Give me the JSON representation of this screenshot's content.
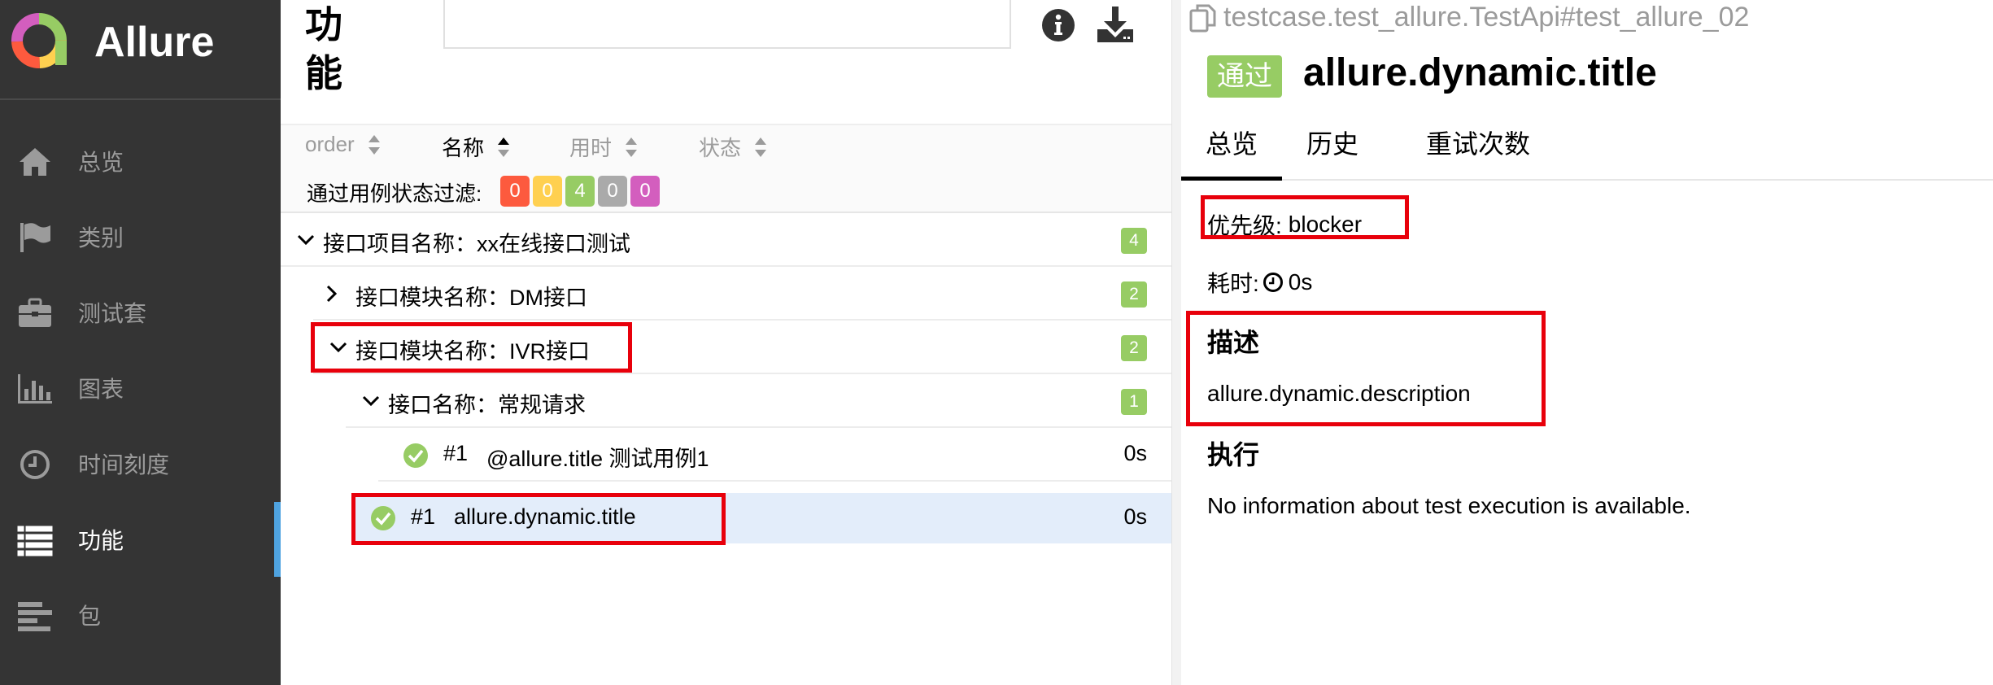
{
  "app": {
    "name": "Allure"
  },
  "sidebar": {
    "items": [
      {
        "label": "总览",
        "icon": "home-icon"
      },
      {
        "label": "类别",
        "icon": "flag-icon"
      },
      {
        "label": "测试套",
        "icon": "briefcase-icon"
      },
      {
        "label": "图表",
        "icon": "bar-chart-icon"
      },
      {
        "label": "时间刻度",
        "icon": "clock-icon"
      },
      {
        "label": "功能",
        "icon": "list-icon",
        "active": true
      },
      {
        "label": "包",
        "icon": "align-left-icon"
      }
    ]
  },
  "middle": {
    "title": "功能",
    "search": {
      "placeholder": ""
    },
    "sort": [
      {
        "label": "order",
        "active": false
      },
      {
        "label": "名称",
        "active": true
      },
      {
        "label": "用时",
        "active": false
      },
      {
        "label": "状态",
        "active": false
      }
    ],
    "filter": {
      "label": "通过用例状态过滤:",
      "chips": [
        {
          "value": "0",
          "color": "#fd5a3e",
          "status": "failed"
        },
        {
          "value": "0",
          "color": "#ffd050",
          "status": "broken"
        },
        {
          "value": "4",
          "color": "#97cc64",
          "status": "passed"
        },
        {
          "value": "0",
          "color": "#aaaaaa",
          "status": "skipped"
        },
        {
          "value": "0",
          "color": "#d35ebe",
          "status": "unknown"
        }
      ]
    },
    "tree": [
      {
        "label": "接口项目名称：xx在线接口测试",
        "count": "4",
        "expanded": true
      },
      {
        "label": "接口模块名称：DM接口",
        "count": "2",
        "expanded": false
      },
      {
        "label": "接口模块名称：IVR接口",
        "count": "2",
        "expanded": true
      },
      {
        "label": "接口名称：常规请求",
        "count": "1",
        "expanded": true
      },
      {
        "order": "#1",
        "label": "@allure.title 测试用例1",
        "duration": "0s"
      },
      {
        "order": "#1",
        "label": "allure.dynamic.title",
        "duration": "0s",
        "selected": true
      }
    ]
  },
  "detail": {
    "fullname": "testcase.test_allure.TestApi#test_allure_02",
    "status_label": "通过",
    "status_color": "#97cc64",
    "title": "allure.dynamic.title",
    "tabs": [
      "总览",
      "历史",
      "重试次数"
    ],
    "severity_label": "优先级:",
    "severity_value": "blocker",
    "duration_label": "耗时:",
    "duration_value": "0s",
    "description_heading": "描述",
    "description_text": "allure.dynamic.description",
    "execution_heading": "执行",
    "execution_text": "No information about test execution is available."
  },
  "highlight_color": "#e8000b"
}
